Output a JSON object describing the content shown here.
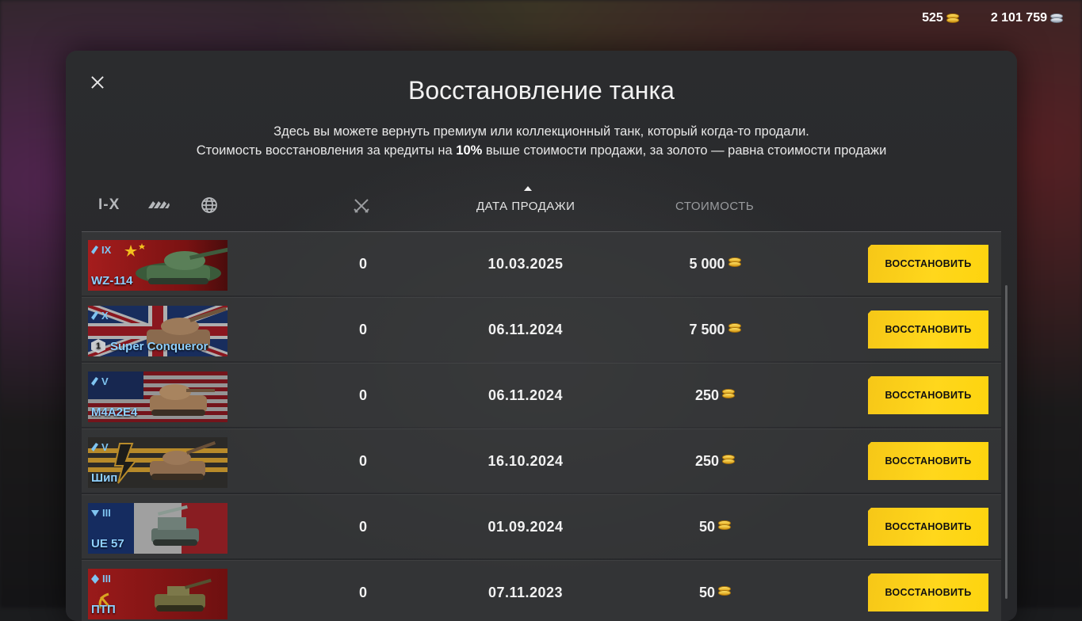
{
  "currency": {
    "gold": "525",
    "silver": "2 101 759"
  },
  "dialog": {
    "title": "Восстановление танка",
    "desc_line1": "Здесь вы можете вернуть премиум или коллекционный танк, который когда-то продали.",
    "desc_line2_pre": "Стоимость восстановления за кредиты на ",
    "desc_line2_bold": "10%",
    "desc_line2_post": " выше стоимости продажи, за золото — равна стоимости продажи"
  },
  "filters": {
    "tier_label": "I-X"
  },
  "columns": {
    "date": "ДАТА ПРОДАЖИ",
    "cost": "СТОИМОСТЬ"
  },
  "rows": [
    {
      "tier": "IX",
      "name": "WZ-114",
      "battles": "0",
      "date": "10.03.2025",
      "cost": "5 000",
      "button": "ВОССТАНОВИТЬ",
      "flag": "china"
    },
    {
      "tier": "X",
      "name": "Super Conqueror",
      "battles": "0",
      "date": "06.11.2024",
      "cost": "7 500",
      "button": "ВОССТАНОВИТЬ",
      "flag": "uk"
    },
    {
      "tier": "V",
      "name": "M4A2E4",
      "battles": "0",
      "date": "06.11.2024",
      "cost": "250",
      "button": "ВОССТАНОВИТЬ",
      "flag": "usa"
    },
    {
      "tier": "V",
      "name": "Шип",
      "battles": "0",
      "date": "16.10.2024",
      "cost": "250",
      "button": "ВОССТАНОВИТЬ",
      "flag": "ussr-ribbon"
    },
    {
      "tier": "III",
      "name": "UE 57",
      "battles": "0",
      "date": "01.09.2024",
      "cost": "50",
      "button": "ВОССТАНОВИТЬ",
      "flag": "france"
    },
    {
      "tier": "III",
      "name": "ПТП",
      "battles": "0",
      "date": "07.11.2023",
      "cost": "50",
      "button": "ВОССТАНОВИТЬ",
      "flag": "ussr"
    }
  ],
  "mastery_badge": "1"
}
